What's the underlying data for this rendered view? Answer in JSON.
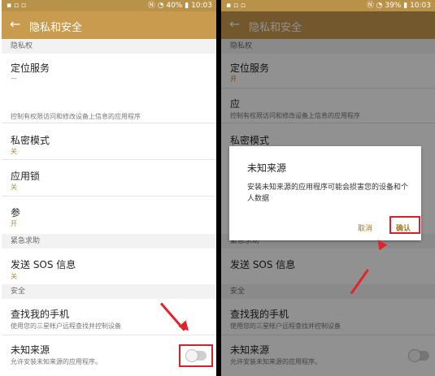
{
  "left": {
    "status": {
      "time": "10:03",
      "battery": "40%"
    },
    "appbar": {
      "title": "隐私和安全"
    },
    "sections": {
      "privacy": "隐私权",
      "emergency": "紧急求助",
      "security": "安全"
    },
    "items": {
      "location": {
        "title": "定位服务"
      },
      "permission_desc": "控制有权限访问和修改设备上信息的应用程序",
      "private_mode": {
        "title": "私密模式",
        "value": "关"
      },
      "app_lock": {
        "title": "应用锁",
        "value": "关"
      },
      "partial": {
        "title": "参",
        "value": "开"
      },
      "sos": {
        "title": "发送 SOS 信息",
        "value": "关"
      },
      "find_phone": {
        "title": "查找我的手机",
        "desc": "使用您的三星帐户远程查找并控制设备"
      },
      "unknown_sources": {
        "title": "未知来源",
        "desc": "允许安装未知来源的应用程序。"
      }
    }
  },
  "right": {
    "status": {
      "time": "10:03",
      "battery": "39%"
    },
    "appbar": {
      "title": "隐私和安全"
    },
    "sections": {
      "privacy": "隐私权",
      "emergency": "紧急求助",
      "security": "安全"
    },
    "items": {
      "location": {
        "title": "定位服务",
        "value": "开"
      },
      "app_partial": {
        "title": "应"
      },
      "permission_desc": "控制有权限访问和修改设备上信息的应用程序",
      "private_mode": {
        "title": "私密模式"
      },
      "app_lock_partial": {
        "title": "应"
      },
      "sos": {
        "title": "发送 SOS 信息"
      },
      "find_phone": {
        "title": "查找我的手机",
        "desc": "使用您的三星帐户远程查找并控制设备"
      },
      "unknown_sources": {
        "title": "未知来源",
        "desc": "允许安装未知来源的应用程序。"
      }
    },
    "dialog": {
      "title": "未知来源",
      "body": "安装未知来源的应用程序可能会损害您的设备和个人数据",
      "cancel": "取消",
      "confirm": "确认"
    }
  },
  "colors": {
    "appbar": "#c89b4e",
    "statusbar": "#b9924a",
    "highlight": "#d3202a",
    "accent_text": "#b08a3c"
  },
  "icons": {
    "back": "back-arrow-icon",
    "toggle": "toggle-switch-icon"
  }
}
